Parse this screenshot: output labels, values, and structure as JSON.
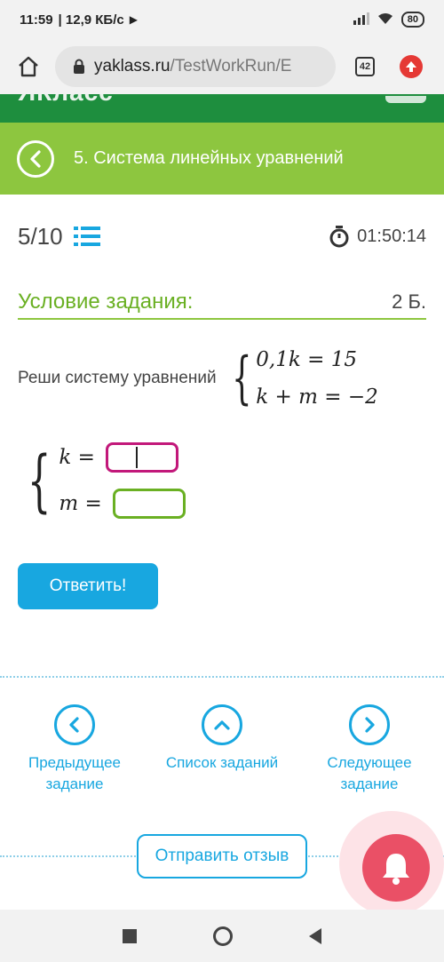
{
  "statusbar": {
    "time": "11:59",
    "speed": "| 12,9 КБ/с",
    "battery": "80"
  },
  "browser": {
    "url_host": "yaklass.ru",
    "url_path": "/TestWorkRun/E",
    "tab_count": "42"
  },
  "topic": {
    "title": "5. Система линейных уравнений"
  },
  "progress": {
    "counter": "5/10",
    "timer": "01:50:14"
  },
  "condition": {
    "title": "Условие задания:",
    "points": "2 Б."
  },
  "task": {
    "text": "Реши систему уравнений",
    "equation1": "0,1k = 15",
    "equation2": "k + m  =  −2"
  },
  "answer": {
    "k_label": "k =",
    "m_label": "m =",
    "k_value": "",
    "m_value": ""
  },
  "actions": {
    "submit_label": "Ответить!",
    "feedback_label": "Отправить отзыв"
  },
  "nav": {
    "prev_label_1": "Предыдущее",
    "prev_label_2": "задание",
    "list_label": "Список заданий",
    "next_label_1": "Следующее",
    "next_label_2": "задание"
  },
  "colors": {
    "green_dark": "#1e8e3e",
    "green_light": "#8dc63f",
    "blue": "#18a7e0",
    "magenta": "#c2187a",
    "bell": "#ea5066"
  }
}
